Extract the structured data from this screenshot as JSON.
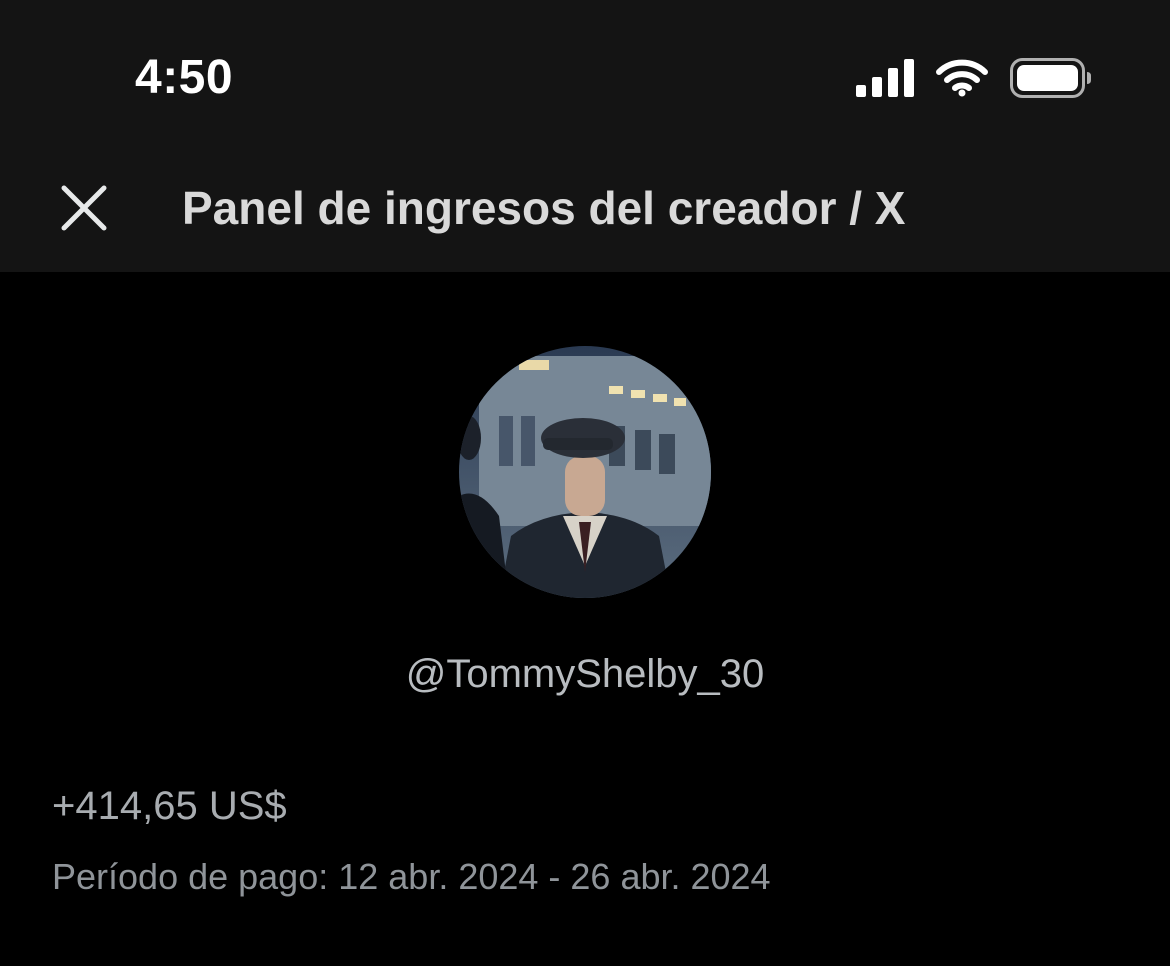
{
  "status_bar": {
    "time": "4:50",
    "icons": [
      "signal-icon",
      "wifi-icon",
      "battery-icon"
    ]
  },
  "nav": {
    "close_icon": "close-icon",
    "title": "Panel de ingresos del creador / X"
  },
  "profile": {
    "avatar_icon": "avatar-photo",
    "handle": "@TommyShelby_30"
  },
  "earnings": {
    "amount": "+414,65 US$",
    "period": "Período de pago: 12 abr. 2024 - 26 abr. 2024"
  },
  "colors": {
    "background": "#000000",
    "header": "#141414",
    "text_primary": "#d9d9d9",
    "text_secondary": "#8f9499"
  }
}
